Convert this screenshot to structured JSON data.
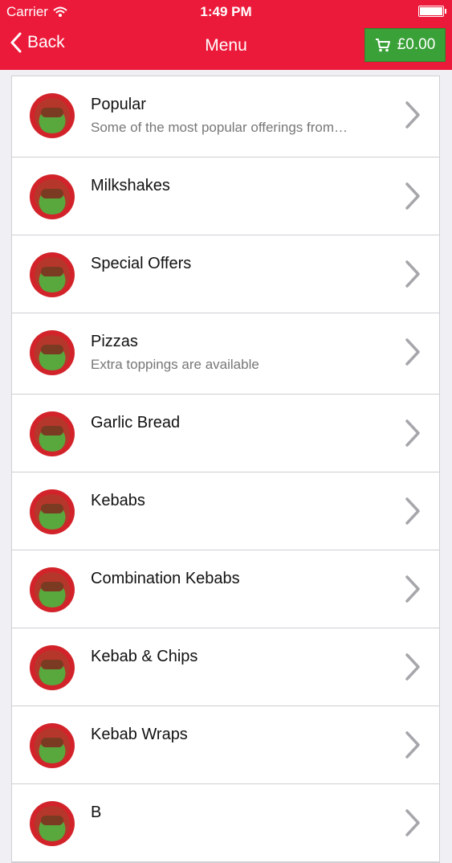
{
  "status_bar": {
    "carrier": "Carrier",
    "time": "1:49 PM"
  },
  "nav": {
    "back_label": "Back",
    "title": "Menu",
    "cart_total": "£0.00"
  },
  "menu_items": [
    {
      "title": "Popular",
      "subtitle": "Some of the most popular offerings from…"
    },
    {
      "title": "Milkshakes",
      "subtitle": ""
    },
    {
      "title": "Special Offers",
      "subtitle": ""
    },
    {
      "title": "Pizzas",
      "subtitle": "Extra toppings are available"
    },
    {
      "title": "Garlic Bread",
      "subtitle": ""
    },
    {
      "title": "Kebabs",
      "subtitle": ""
    },
    {
      "title": "Combination Kebabs",
      "subtitle": ""
    },
    {
      "title": "Kebab & Chips",
      "subtitle": ""
    },
    {
      "title": "Kebab Wraps",
      "subtitle": ""
    },
    {
      "title": "B",
      "subtitle": ""
    }
  ],
  "colors": {
    "brand_red": "#ec1a3a",
    "cart_green": "#3aa138"
  }
}
